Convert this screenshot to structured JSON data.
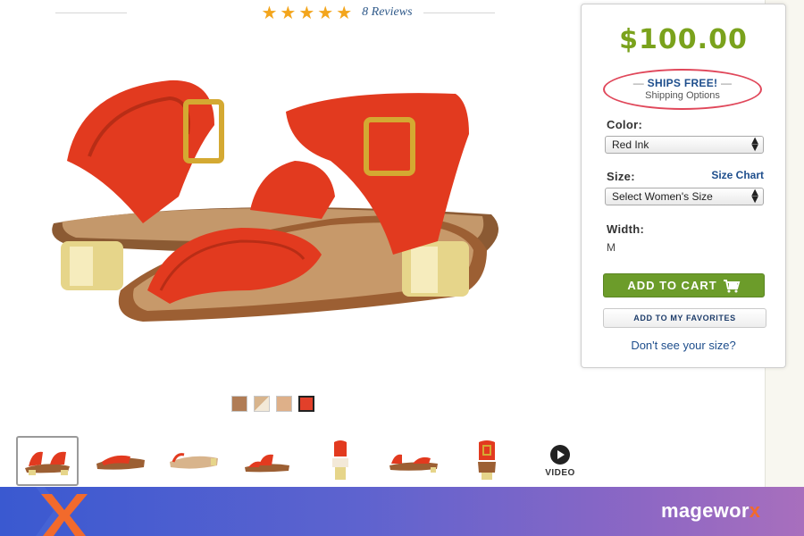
{
  "rating": {
    "stars": 5,
    "star_glyph": "★",
    "reviews_label": "8 Reviews",
    "star_color": "#f3a51c"
  },
  "product": {
    "image_name": "red-ankle-strap-sandal",
    "swatches": [
      {
        "name": "Tan",
        "color": "#b07c55"
      },
      {
        "name": "Natural",
        "color": "#d8b48c"
      },
      {
        "name": "Light Tan",
        "color": "#deb089"
      },
      {
        "name": "Red Ink",
        "color": "#e2402a",
        "selected": true
      }
    ],
    "thumbnails": [
      "angle-view",
      "side-view",
      "sole-view",
      "front-view",
      "heel-view",
      "outer-side-view",
      "back-view"
    ],
    "video_label": "VIDEO"
  },
  "buy_box": {
    "price": "$100.00",
    "ships_free": "SHIPS FREE!",
    "ships_dash": "—",
    "shipping_options": "Shipping Options",
    "color_label": "Color:",
    "color_value": "Red Ink",
    "size_label": "Size:",
    "size_chart": "Size Chart",
    "size_value": "Select Women's Size",
    "width_label": "Width:",
    "width_value": "M",
    "add_to_cart": "ADD TO CART",
    "add_to_favorites": "ADD TO MY FAVORITES",
    "dont_see_size": "Don't see your size?",
    "select_arrows": "▲▼",
    "price_color": "#7aa21c",
    "cart_button_color": "#6c9c2a"
  },
  "banner": {
    "brand_prefix": "magewor",
    "brand_suffix": "x"
  }
}
